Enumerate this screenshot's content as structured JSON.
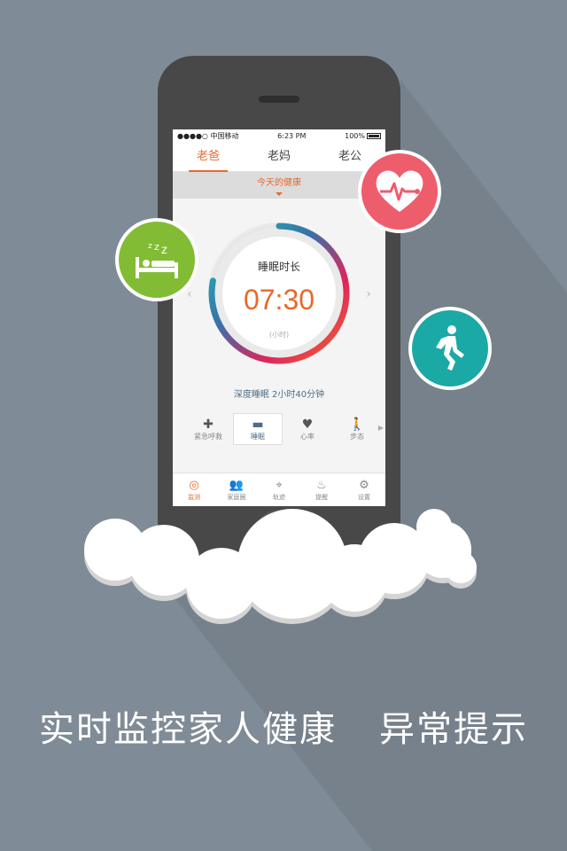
{
  "status_bar": {
    "carrier": "●●●●○ 中国移动",
    "time": "6:23 PM",
    "battery": "100%"
  },
  "tabs": [
    {
      "label": "老爸",
      "active": true
    },
    {
      "label": "老妈",
      "active": false
    },
    {
      "label": "老公",
      "active": false
    }
  ],
  "date_selector": {
    "label": "今天的健康"
  },
  "dial": {
    "title": "睡眠时长",
    "value": "07:30",
    "unit": "(小时)",
    "progress": 0.78
  },
  "deep_sleep": "深度睡眠  2小时40分钟",
  "metrics": [
    {
      "label": "紧急呼救",
      "icon": "plus-icon",
      "glyph": "✚",
      "active": false
    },
    {
      "label": "睡眠",
      "icon": "bed-icon",
      "glyph": "▬",
      "active": true
    },
    {
      "label": "心率",
      "icon": "heart-icon",
      "glyph": "♥",
      "active": false
    },
    {
      "label": "步态",
      "icon": "walk-icon",
      "glyph": "🚶",
      "active": false
    }
  ],
  "bottom_tabs": [
    {
      "label": "监测",
      "icon": "monitor-icon",
      "glyph": "◎",
      "active": true
    },
    {
      "label": "家庭圈",
      "icon": "family-icon",
      "glyph": "👥",
      "active": false
    },
    {
      "label": "轨迹",
      "icon": "location-icon",
      "glyph": "⌖",
      "active": false
    },
    {
      "label": "提醒",
      "icon": "reminder-icon",
      "glyph": "♨",
      "active": false
    },
    {
      "label": "设置",
      "icon": "gear-icon",
      "glyph": "⚙",
      "active": false
    }
  ],
  "tagline": {
    "part1": "实时监控家人健康",
    "part2": "异常提示"
  },
  "colors": {
    "background": "#7f8b96",
    "accent": "#e8692c",
    "sleep_badge": "#82bc34",
    "heart_badge": "#ee5d6c",
    "walk_badge": "#1ba9a5",
    "phone_body": "#484848"
  }
}
